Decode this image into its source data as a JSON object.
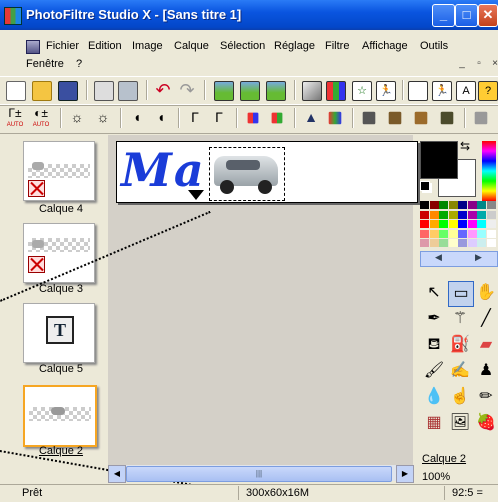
{
  "window": {
    "title": "PhotoFiltre Studio X - [Sans titre 1]"
  },
  "title_buttons": {
    "minimize": "_",
    "maximize": "□",
    "close": "✕"
  },
  "menu": {
    "items": [
      "Fichier",
      "Edition",
      "Image",
      "Calque",
      "Sélection",
      "Réglage",
      "Filtre",
      "Affichage",
      "Outils"
    ],
    "row2": [
      "Fenêtre",
      "?"
    ],
    "mdi_buttons": [
      "_",
      "▫",
      "×"
    ]
  },
  "layers": [
    {
      "label": "Calque 4",
      "visible": false
    },
    {
      "label": "Calque 3",
      "visible": false
    },
    {
      "label": "Calque 5",
      "visible": true,
      "thumb_text": "T"
    },
    {
      "label": "Calque 2",
      "visible": true,
      "selected": true
    }
  ],
  "canvas": {
    "text": "Ma r"
  },
  "right_panel": {
    "active_layer": "Calque 2",
    "zoom": "100%",
    "colors": {
      "foreground": "#000000",
      "background": "#ffffff"
    }
  },
  "status": {
    "state": "Prêt",
    "size": "300x60x16M",
    "zoom": "92:5 ="
  },
  "scroll": {
    "left_arrow": "◀",
    "right_arrow": "▶",
    "grip": "|||"
  },
  "toolbar_icons": {
    "row1": [
      "new-icon",
      "open-icon",
      "save-icon",
      "print-icon",
      "scan-icon",
      "undo-icon",
      "redo-icon",
      "image-icon",
      "image2-icon",
      "image3-icon",
      "grayscale-icon",
      "color-icon",
      "run-icon",
      "doc-icon",
      "doc-run-icon",
      "doc-text-icon",
      "hand-icon"
    ],
    "row2_labels": [
      "AUTO",
      "AUTO"
    ]
  }
}
